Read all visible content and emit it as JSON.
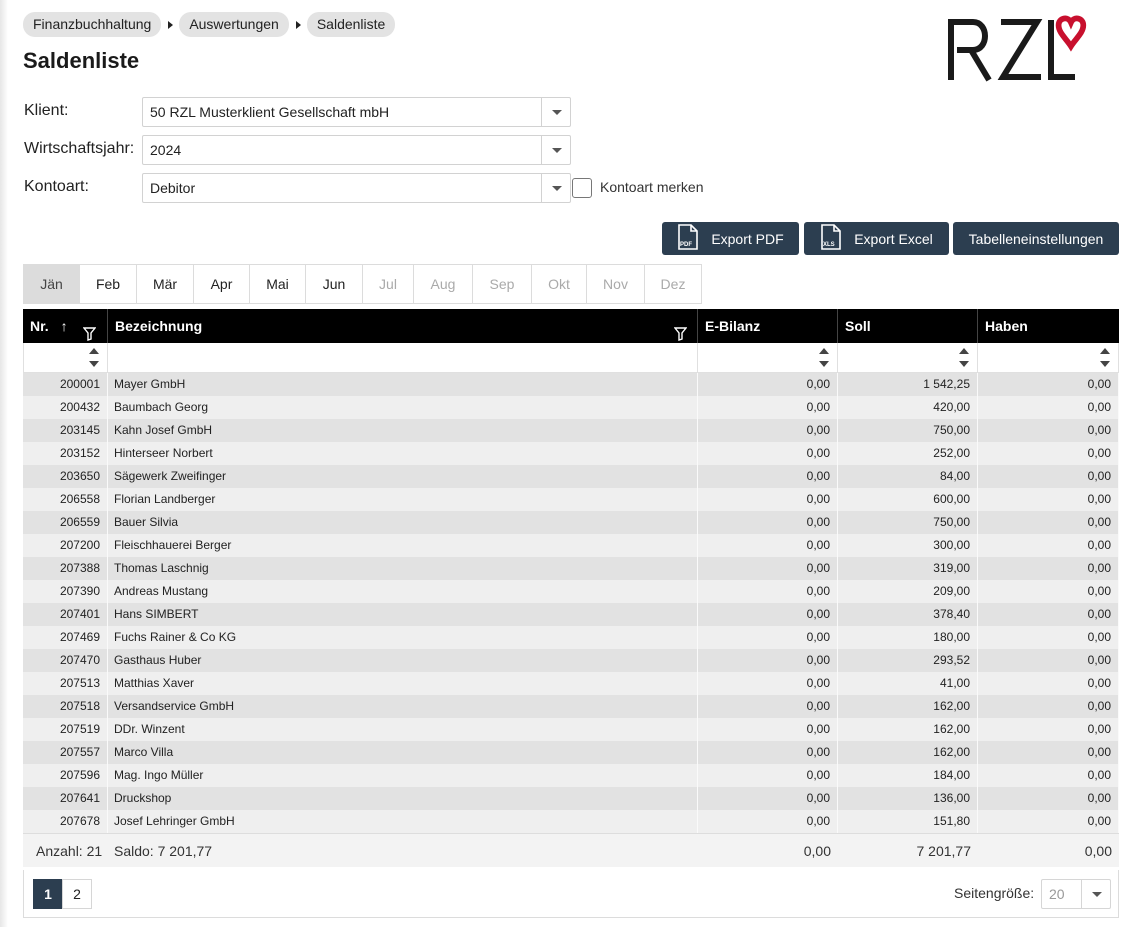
{
  "breadcrumb": [
    "Finanzbuchhaltung",
    "Auswertungen",
    "Saldenliste"
  ],
  "page_title": "Saldenliste",
  "logo_text": "RZL",
  "brand_colors": {
    "accent": "#c8102e",
    "button": "#2c3e50",
    "header": "#000000"
  },
  "form": {
    "klient_label": "Klient:",
    "klient_value": "50 RZL Musterklient Gesellschaft mbH",
    "wj_label": "Wirtschaftsjahr:",
    "wj_value": "2024",
    "kontoart_label": "Kontoart:",
    "kontoart_value": "Debitor",
    "merken_label": "Kontoart merken",
    "merken_checked": false
  },
  "buttons": {
    "export_pdf": "Export PDF",
    "pdf_icon_text": "PDF",
    "export_excel": "Export Excel",
    "xls_icon_text": "XLS",
    "table_settings": "Tabelleneinstellungen"
  },
  "months": [
    {
      "label": "Jän",
      "state": "active"
    },
    {
      "label": "Feb",
      "state": "enabled"
    },
    {
      "label": "Mär",
      "state": "enabled"
    },
    {
      "label": "Apr",
      "state": "enabled"
    },
    {
      "label": "Mai",
      "state": "enabled"
    },
    {
      "label": "Jun",
      "state": "enabled"
    },
    {
      "label": "Jul",
      "state": "disabled"
    },
    {
      "label": "Aug",
      "state": "disabled"
    },
    {
      "label": "Sep",
      "state": "disabled"
    },
    {
      "label": "Okt",
      "state": "disabled"
    },
    {
      "label": "Nov",
      "state": "disabled"
    },
    {
      "label": "Dez",
      "state": "disabled"
    }
  ],
  "table": {
    "columns": {
      "nr": "Nr.",
      "bezeichnung": "Bezeichnung",
      "ebilanz": "E-Bilanz",
      "soll": "Soll",
      "haben": "Haben"
    },
    "rows": [
      [
        "200001",
        "Mayer GmbH",
        "0,00",
        "1 542,25",
        "0,00"
      ],
      [
        "200432",
        "Baumbach Georg",
        "0,00",
        "420,00",
        "0,00"
      ],
      [
        "203145",
        "Kahn Josef GmbH",
        "0,00",
        "750,00",
        "0,00"
      ],
      [
        "203152",
        "Hinterseer Norbert",
        "0,00",
        "252,00",
        "0,00"
      ],
      [
        "203650",
        "Sägewerk Zweifinger",
        "0,00",
        "84,00",
        "0,00"
      ],
      [
        "206558",
        "Florian Landberger",
        "0,00",
        "600,00",
        "0,00"
      ],
      [
        "206559",
        "Bauer Silvia",
        "0,00",
        "750,00",
        "0,00"
      ],
      [
        "207200",
        "Fleischhauerei Berger",
        "0,00",
        "300,00",
        "0,00"
      ],
      [
        "207388",
        "Thomas Laschnig",
        "0,00",
        "319,00",
        "0,00"
      ],
      [
        "207390",
        "Andreas Mustang",
        "0,00",
        "209,00",
        "0,00"
      ],
      [
        "207401",
        "Hans SIMBERT",
        "0,00",
        "378,40",
        "0,00"
      ],
      [
        "207469",
        "Fuchs Rainer & Co KG",
        "0,00",
        "180,00",
        "0,00"
      ],
      [
        "207470",
        "Gasthaus Huber",
        "0,00",
        "293,52",
        "0,00"
      ],
      [
        "207513",
        "Matthias Xaver",
        "0,00",
        "41,00",
        "0,00"
      ],
      [
        "207518",
        "Versandservice GmbH",
        "0,00",
        "162,00",
        "0,00"
      ],
      [
        "207519",
        "DDr. Winzent",
        "0,00",
        "162,00",
        "0,00"
      ],
      [
        "207557",
        "Marco Villa",
        "0,00",
        "162,00",
        "0,00"
      ],
      [
        "207596",
        "Mag. Ingo Müller",
        "0,00",
        "184,00",
        "0,00"
      ],
      [
        "207641",
        "Druckshop",
        "0,00",
        "136,00",
        "0,00"
      ],
      [
        "207678",
        "Josef Lehringer GmbH",
        "0,00",
        "151,80",
        "0,00"
      ]
    ],
    "footer": {
      "anzahl": "Anzahl: 21",
      "saldo": "Saldo: 7 201,77",
      "ebilanz": "0,00",
      "soll": "7 201,77",
      "haben": "0,00"
    }
  },
  "pager": {
    "pages": [
      "1",
      "2"
    ],
    "current_page": "1",
    "page_size_label": "Seitengröße:",
    "page_size": "20"
  }
}
